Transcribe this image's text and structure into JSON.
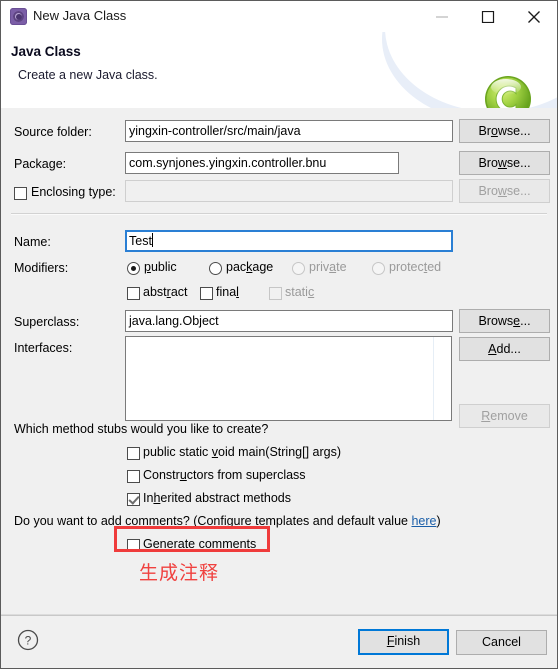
{
  "window": {
    "title": "New Java Class",
    "icon": "java-class-wizard-icon",
    "controls": {
      "minimize": "minimize-icon",
      "maximize": "maximize-icon",
      "close": "close-icon"
    }
  },
  "banner": {
    "title": "Java Class",
    "subtitle": "Create a new Java class.",
    "logo": "green-c-sphere-logo",
    "logo_letter": "C"
  },
  "form": {
    "source_folder": {
      "label": "Source folder:",
      "value": "yingxin-controller/src/main/java",
      "browse_label_pre": "Br",
      "browse_label_mn": "o",
      "browse_label_post": "wse..."
    },
    "package": {
      "label": "Package:",
      "value": "com.synjones.yingxin.controller.bnu",
      "browse_label_pre": "Bro",
      "browse_label_mn": "w",
      "browse_label_post": "se..."
    },
    "enclosing_type": {
      "label": "Enclosing type:",
      "checked": false,
      "value": "",
      "browse_label_pre": "Bro",
      "browse_label_mn": "w",
      "browse_label_post": "se...",
      "browse_disabled": true
    },
    "name": {
      "label": "Name:",
      "value": "Test",
      "focused": true
    },
    "modifiers": {
      "label": "Modifiers:",
      "access": [
        {
          "label_pre": "",
          "label_mn": "p",
          "label_post": "ublic",
          "selected": true,
          "disabled": false
        },
        {
          "label_pre": "pac",
          "label_mn": "k",
          "label_post": "age",
          "selected": false,
          "disabled": false
        },
        {
          "label_pre": "priv",
          "label_mn": "a",
          "label_post": "te",
          "selected": false,
          "disabled": true
        },
        {
          "label_pre": "protec",
          "label_mn": "t",
          "label_post": "ed",
          "selected": false,
          "disabled": true
        }
      ],
      "flags": [
        {
          "label_pre": "abst",
          "label_mn": "r",
          "label_post": "act",
          "checked": false,
          "disabled": false
        },
        {
          "label_pre": "fina",
          "label_mn": "l",
          "label_post": "",
          "checked": false,
          "disabled": false
        },
        {
          "label_pre": "stati",
          "label_mn": "c",
          "label_post": "",
          "checked": false,
          "disabled": true
        }
      ]
    },
    "superclass": {
      "label": "Superclass:",
      "value": "java.lang.Object",
      "browse_label_pre": "Brows",
      "browse_label_mn": "e",
      "browse_label_post": "..."
    },
    "interfaces": {
      "label": "Interfaces:",
      "items": [],
      "add_label_pre": "",
      "add_label_mn": "A",
      "add_label_post": "dd...",
      "remove_label_pre": "",
      "remove_label_mn": "R",
      "remove_label_post": "emove",
      "remove_disabled": true
    }
  },
  "stubs": {
    "question": "Which method stubs would you like to create?",
    "options": [
      {
        "label_pre": "public static ",
        "label_mn": "v",
        "label_post": "oid main(String[] args)",
        "checked": false
      },
      {
        "label_pre": "Constr",
        "label_mn": "u",
        "label_post": "ctors from superclass",
        "checked": false
      },
      {
        "label_pre": "In",
        "label_mn": "h",
        "label_post": "erited abstract methods",
        "checked": true
      }
    ]
  },
  "comments": {
    "question_pre": "Do you want to add comments? (Configure templates and default value ",
    "link": "here",
    "question_post": ")",
    "generate": {
      "label_pre": "",
      "label_mn": "G",
      "label_post": "enerate comments",
      "checked": false
    }
  },
  "annotation": {
    "highlight_target": "generate-comments-checkbox",
    "text": "生成注释",
    "color": "#f0413f"
  },
  "footer": {
    "help": "help-icon",
    "finish": {
      "label_pre": "",
      "label_mn": "F",
      "label_post": "inish",
      "is_default": true
    },
    "cancel": {
      "label": "Cancel"
    }
  },
  "colors": {
    "dialog_bg": "#f0f0f0",
    "banner_bg": "#ffffff",
    "accent_blue": "#0078d7",
    "link_blue": "#1a5ea8",
    "annotation_red": "#ef3b3b",
    "logo_green": "#8bc53f"
  }
}
